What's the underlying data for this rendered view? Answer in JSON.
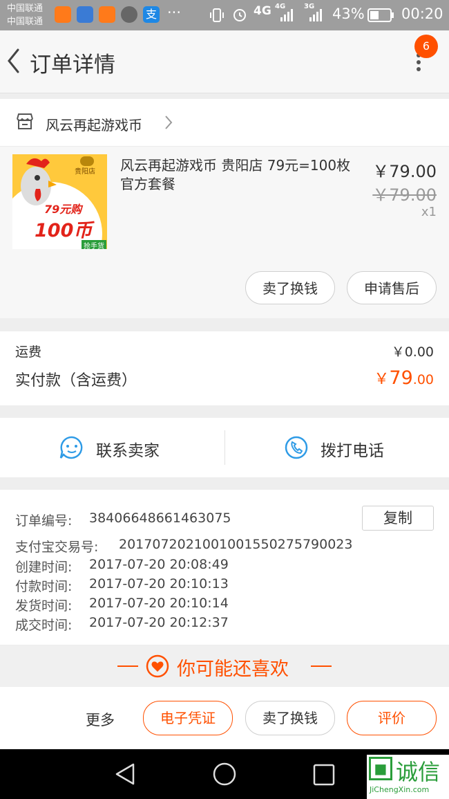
{
  "status_bar": {
    "carrier_1": "中国联通",
    "carrier_2": "中国联通",
    "more": "···",
    "net_1": "4G",
    "net_2": "4G",
    "net_3": "3G",
    "battery": "43%",
    "time": "00:20"
  },
  "header": {
    "title": "订单详情",
    "badge_count": "6"
  },
  "shop": {
    "name": "风云再起游戏币"
  },
  "product": {
    "image_text_price": "79元购",
    "image_text_coin": "100币",
    "image_text_store": "贵阳店",
    "image_text_tag": "抢手货",
    "title": "风云再起游戏币 贵阳店 79元=100枚官方套餐",
    "price": "￥79.00",
    "original_price": "￥79.00",
    "quantity": "x1",
    "btn_resell": "卖了换钱",
    "btn_aftersale": "申请售后"
  },
  "payment": {
    "shipping_label": "运费",
    "shipping_value": "￥0.00",
    "paid_label": "实付款（含运费）",
    "paid_currency": "￥",
    "paid_int": "79",
    "paid_dec": ".00"
  },
  "contact": {
    "seller": "联系卖家",
    "phone": "拨打电话"
  },
  "order_info": {
    "order_no_label": "订单编号:",
    "order_no": "38406648661463075",
    "copy": "复制",
    "alipay_label": "支付宝交易号:",
    "alipay_no": "2017072021001001550275790023",
    "created_label": "创建时间:",
    "created": "2017-07-20 20:08:49",
    "paid_label": "付款时间:",
    "paid": "2017-07-20 20:10:13",
    "shipped_label": "发货时间:",
    "shipped": "2017-07-20 20:10:14",
    "done_label": "成交时间:",
    "done": "2017-07-20 20:12:37"
  },
  "recommend": {
    "title": "你可能还喜欢"
  },
  "bottom_bar": {
    "more": "更多",
    "voucher": "电子凭证",
    "resell": "卖了换钱",
    "review": "评价"
  },
  "watermark": {
    "brand": "诚信",
    "url": "JiChengXin.com"
  },
  "colors": {
    "accent": "#ff5000",
    "blue": "#2e9be6"
  }
}
